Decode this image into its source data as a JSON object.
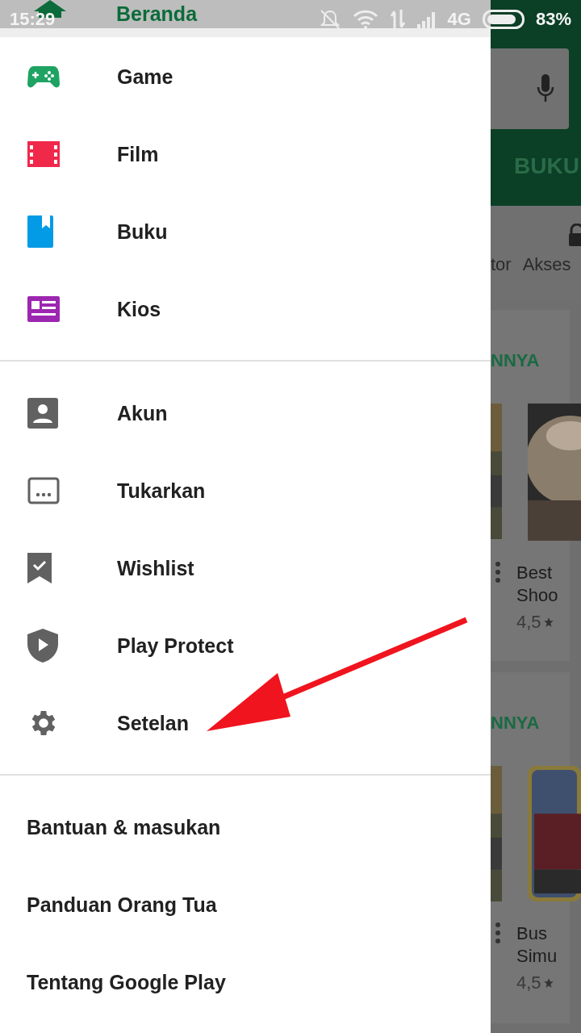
{
  "status_bar": {
    "time": "15:29",
    "network": "4G",
    "battery": "83%"
  },
  "drawer": {
    "header": "Beranda",
    "sections": [
      {
        "kind": "icon",
        "items": [
          {
            "label": "Game"
          },
          {
            "label": "Film"
          },
          {
            "label": "Buku"
          },
          {
            "label": "Kios"
          }
        ]
      },
      {
        "kind": "icon",
        "items": [
          {
            "label": "Akun"
          },
          {
            "label": "Tukarkan"
          },
          {
            "label": "Wishlist"
          },
          {
            "label": "Play Protect"
          },
          {
            "label": "Setelan"
          }
        ]
      },
      {
        "kind": "text",
        "items": [
          {
            "label": "Bantuan & masukan"
          },
          {
            "label": "Panduan Orang Tua"
          },
          {
            "label": "Tentang Google Play"
          }
        ]
      }
    ]
  },
  "background": {
    "tab": "BUKU",
    "categories": [
      "tor",
      "Akses"
    ],
    "sections": [
      {
        "heading": "NNYA",
        "app": {
          "title_lines": [
            "Best",
            "Shoo"
          ],
          "rating": "4,5"
        }
      },
      {
        "heading": "NNYA",
        "app": {
          "title_lines": [
            "Bus",
            "Simu"
          ],
          "rating": "4,5"
        }
      }
    ]
  }
}
